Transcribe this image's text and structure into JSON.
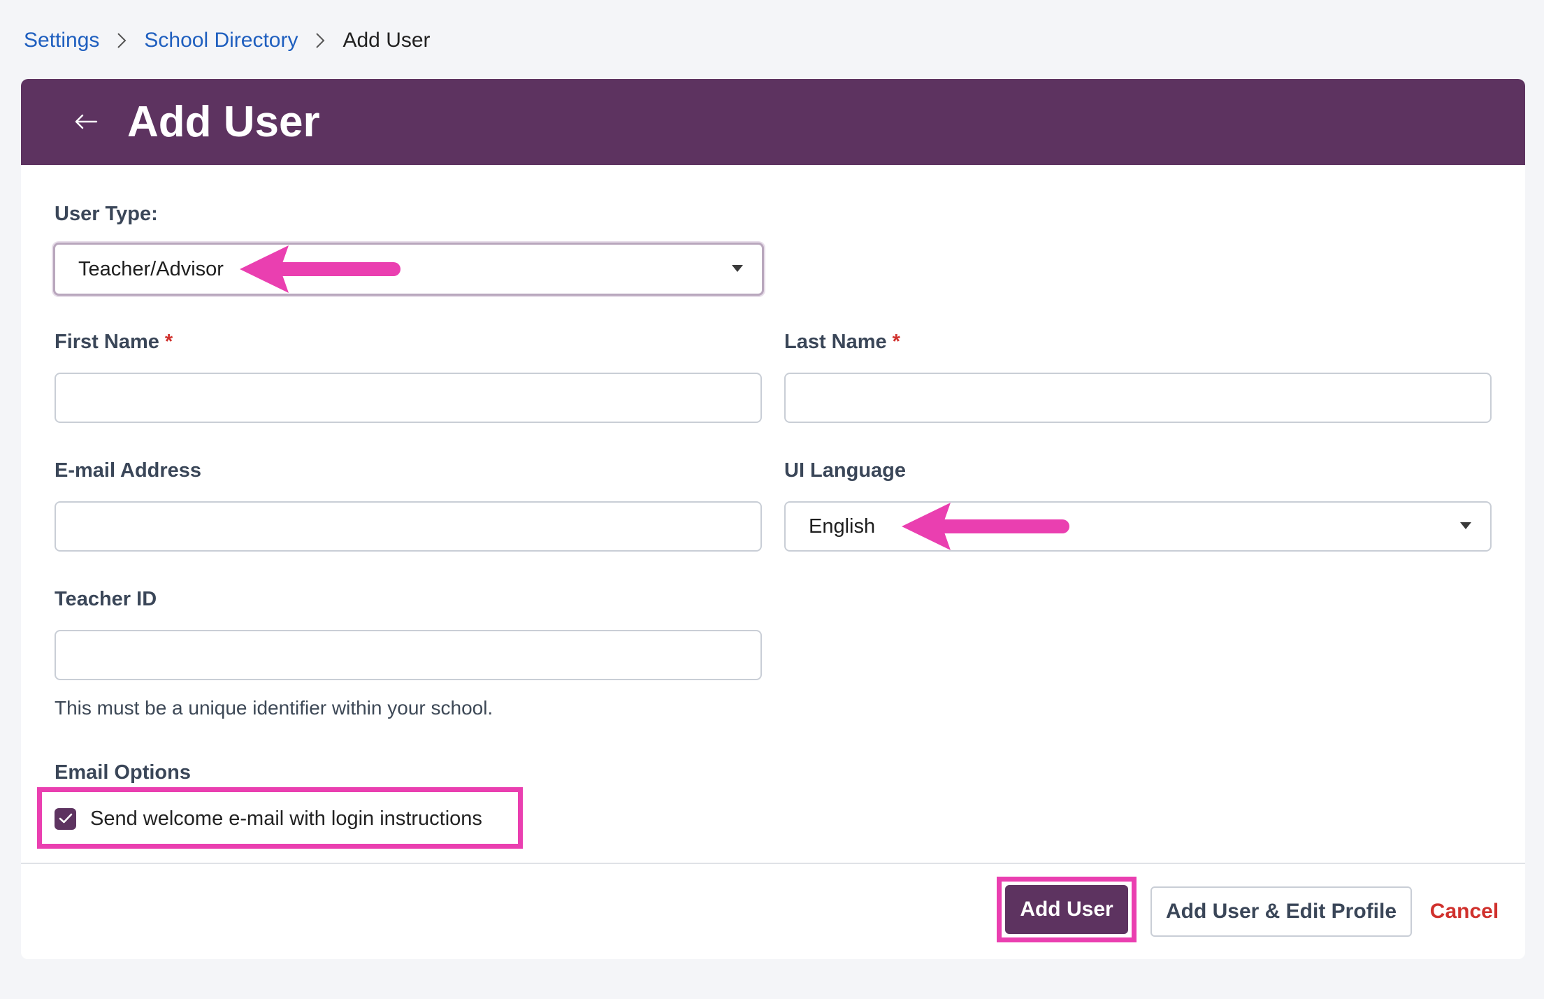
{
  "breadcrumb": {
    "items": [
      "Settings",
      "School Directory"
    ],
    "current": "Add User"
  },
  "header": {
    "title": "Add User",
    "back_icon": "arrow-left-icon"
  },
  "form": {
    "user_type": {
      "label": "User Type:",
      "value": "Teacher/Advisor"
    },
    "first_name": {
      "label": "First Name",
      "required_mark": "*",
      "value": ""
    },
    "last_name": {
      "label": "Last Name",
      "required_mark": "*",
      "value": ""
    },
    "email": {
      "label": "E-mail Address",
      "value": ""
    },
    "ui_language": {
      "label": "UI Language",
      "value": "English"
    },
    "teacher_id": {
      "label": "Teacher ID",
      "value": "",
      "helper": "This must be a unique identifier within your school."
    },
    "email_options": {
      "label": "Email Options",
      "checkbox_label": "Send welcome e-mail with login instructions",
      "checked": true
    }
  },
  "footer": {
    "add_user_label": "Add User",
    "add_edit_label": "Add User & Edit Profile",
    "cancel_label": "Cancel"
  },
  "colors": {
    "brand_purple": "#5d3360",
    "link_blue": "#1f5fbf",
    "danger_red": "#d0312d",
    "annotation_pink": "#ea3fb0"
  }
}
